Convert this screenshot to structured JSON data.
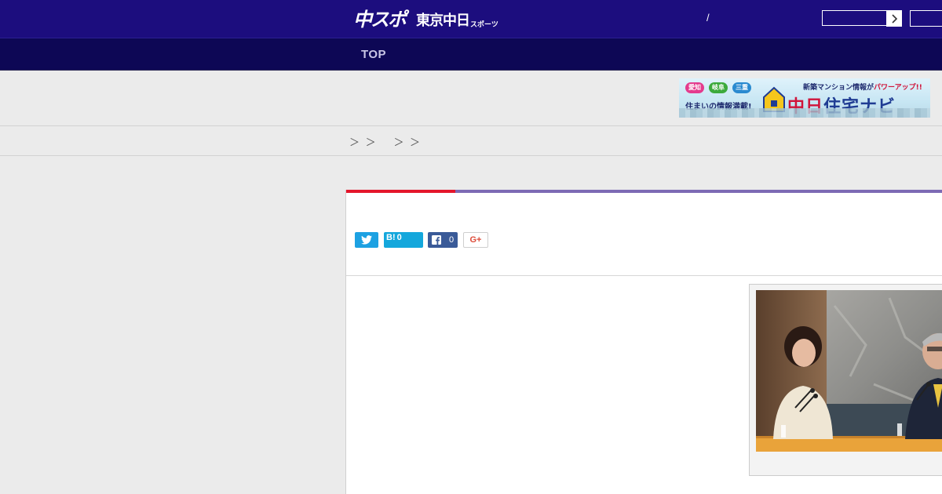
{
  "header": {
    "logo_main": "中スポ",
    "logo_sub": "東京中日",
    "logo_tiny": "スポーツ",
    "slash": "/",
    "bg_color": "#1c0d7e"
  },
  "nav": {
    "top_label": "TOP",
    "bg_color": "#0d0755"
  },
  "banner": {
    "pill_1": "愛知",
    "pill_2": "岐阜",
    "pill_3": "三重",
    "tagline": "住まいの情報満載!",
    "headline_prefix": "新築マンション情報が",
    "headline_accent": "パワーアップ!!",
    "brand_1": "中日",
    "brand_2": "住宅ナビ"
  },
  "breadcrumb": {
    "text": "＞ ＞   ＞ ＞"
  },
  "share": {
    "hatena_label": "B!",
    "hatena_count": "0",
    "facebook_count": "0",
    "gplus_label": "G+"
  },
  "colors": {
    "accent_red": "#e4162b",
    "accent_purple": "#7d6ab4",
    "twitter_blue": "#1da1e2",
    "hatena_blue": "#14a7dc",
    "facebook_blue": "#3a5a98"
  },
  "icons": {
    "twitter": "twitter-bird-icon",
    "facebook": "facebook-f-icon",
    "search_arrow": "chevron-right-icon"
  }
}
